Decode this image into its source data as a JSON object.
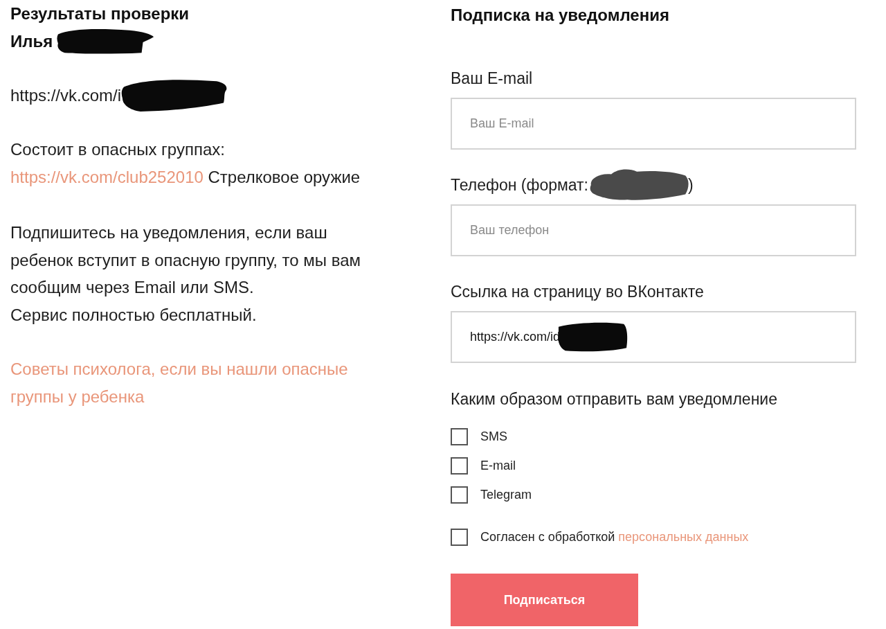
{
  "results": {
    "title": "Результаты проверки",
    "name": {
      "text": "Илья",
      "redacted": true
    },
    "profile_link": {
      "text": "https://vk.com/i",
      "redacted": true
    },
    "groups_label": "Состоит в опасных группах:",
    "groups": [
      {
        "link": "https://vk.com/club252010",
        "name": "Стрелковое оружие"
      }
    ],
    "subscribe_text": "Подпишитесь на уведомления, если ваш ребенок вступит в опасную группу, то мы вам сообщим через Email или SMS.",
    "free_text": "Сервис полностью бесплатный.",
    "advice_link": "Советы психолога, если вы нашли опасные группы у ребенка"
  },
  "subscription": {
    "title": "Подписка на уведомления",
    "fields": [
      {
        "label": "Ваш E-mail",
        "placeholder": "Ваш E-mail"
      },
      {
        "label": "Телефон (формат:",
        "label_tail": ")",
        "label_redacted": true,
        "placeholder": "Ваш телефон"
      },
      {
        "label": "Ссылка на страницу во ВКонтакте",
        "value": "https://vk.com/id",
        "value_redacted": true
      }
    ],
    "methods_label": "Каким образом отправить вам уведомление",
    "methods": [
      {
        "label": "SMS",
        "checked": false
      },
      {
        "label": "E-mail",
        "checked": false
      },
      {
        "label": "Telegram",
        "checked": false
      }
    ],
    "consent": {
      "text": "Согласен с обработкой",
      "link": "персональных данных",
      "checked": false
    },
    "submit": "Подписаться"
  }
}
